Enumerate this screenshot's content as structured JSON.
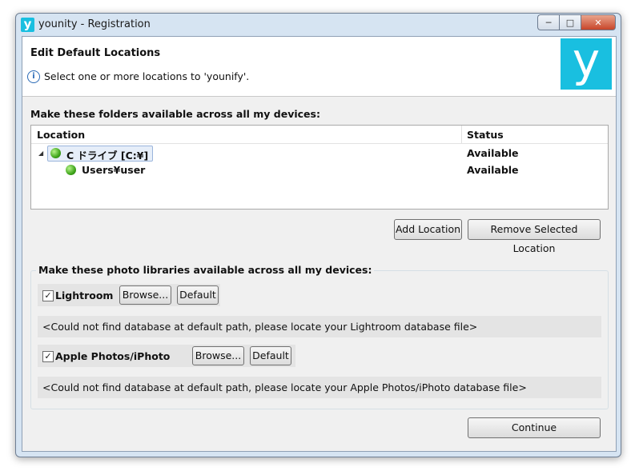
{
  "window": {
    "title": "younity - Registration",
    "app_icon_letter": "y",
    "controls": {
      "minimize": "─",
      "maximize": "□",
      "close": "✕"
    }
  },
  "header": {
    "title": "Edit Default Locations",
    "description": "Select one or more locations to 'younify'.",
    "info_icon": "i",
    "logo_letter": "y"
  },
  "folders": {
    "label": "Make these folders available across all my devices:",
    "columns": {
      "location": "Location",
      "status": "Status"
    },
    "rows": [
      {
        "name": "C ドライブ [C:¥]",
        "status": "Available",
        "level": 0,
        "expanded": true,
        "selected": true
      },
      {
        "name": "Users¥user",
        "status": "Available",
        "level": 1
      }
    ],
    "add_button": "Add Location",
    "remove_button": "Remove Selected Location"
  },
  "photo_libraries": {
    "label": "Make these photo libraries available across all my devices:",
    "lightroom": {
      "name": "Lightroom",
      "checked": true,
      "browse": "Browse...",
      "default": "Default",
      "path": "<Could not find database at default path, please locate your Lightroom database file>"
    },
    "apple": {
      "name": "Apple Photos/iPhoto",
      "checked": true,
      "browse": "Browse...",
      "default": "Default",
      "path": "<Could not find database at default path, please locate your Apple Photos/iPhoto database file>"
    }
  },
  "footer": {
    "continue": "Continue"
  },
  "colors": {
    "brand": "#19bfe0",
    "status_ok": "#3fa51b"
  }
}
